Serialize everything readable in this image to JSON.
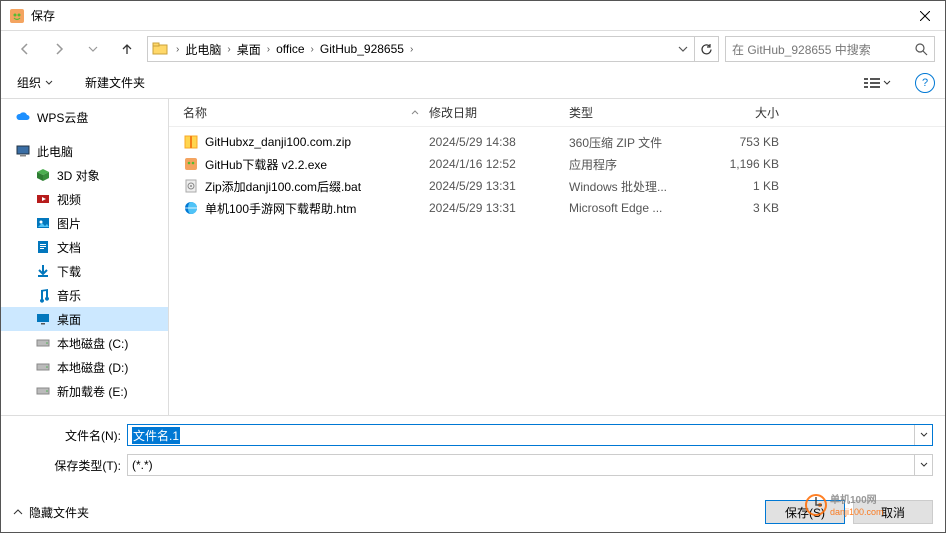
{
  "title": "保存",
  "nav": {
    "crumbs": [
      "此电脑",
      "桌面",
      "office",
      "GitHub_928655"
    ],
    "search_placeholder": "在 GitHub_928655 中搜索"
  },
  "toolbar": {
    "organize": "组织",
    "newfolder": "新建文件夹"
  },
  "sidebar": {
    "top": [
      {
        "label": "WPS云盘",
        "icon": "cloud",
        "color": "#1e90ff"
      }
    ],
    "pc_label": "此电脑",
    "items": [
      {
        "label": "3D 对象",
        "icon": "cube",
        "color": "#2e7d32"
      },
      {
        "label": "视频",
        "icon": "video",
        "color": "#b71c1c"
      },
      {
        "label": "图片",
        "icon": "image",
        "color": "#0277bd"
      },
      {
        "label": "文档",
        "icon": "doc",
        "color": "#0277bd"
      },
      {
        "label": "下载",
        "icon": "download",
        "color": "#0277bd"
      },
      {
        "label": "音乐",
        "icon": "music",
        "color": "#0277bd"
      },
      {
        "label": "桌面",
        "icon": "desktop",
        "color": "#0277bd",
        "selected": true
      },
      {
        "label": "本地磁盘 (C:)",
        "icon": "drive",
        "color": "#888"
      },
      {
        "label": "本地磁盘 (D:)",
        "icon": "drive",
        "color": "#888"
      },
      {
        "label": "新加载卷 (E:)",
        "icon": "drive",
        "color": "#888"
      }
    ]
  },
  "columns": {
    "name": "名称",
    "date": "修改日期",
    "type": "类型",
    "size": "大小"
  },
  "files": [
    {
      "name": "GitHubxz_danji100.com.zip",
      "date": "2024/5/29 14:38",
      "type": "360压缩 ZIP 文件",
      "size": "753 KB",
      "icon": "zip"
    },
    {
      "name": "GitHub下载器 v2.2.exe",
      "date": "2024/1/16 12:52",
      "type": "应用程序",
      "size": "1,196 KB",
      "icon": "exe"
    },
    {
      "name": "Zip添加danji100.com后缀.bat",
      "date": "2024/5/29 13:31",
      "type": "Windows 批处理...",
      "size": "1 KB",
      "icon": "bat"
    },
    {
      "name": "单机100手游网下载帮助.htm",
      "date": "2024/5/29 13:31",
      "type": "Microsoft Edge ...",
      "size": "3 KB",
      "icon": "htm"
    }
  ],
  "form": {
    "filename_label": "文件名(N):",
    "filename_value": "文件名.1",
    "type_label": "保存类型(T):",
    "type_value": "(*.*)"
  },
  "footer": {
    "hide": "隐藏文件夹",
    "save": "保存(S)",
    "cancel": "取消"
  },
  "watermark": "danji100.com"
}
